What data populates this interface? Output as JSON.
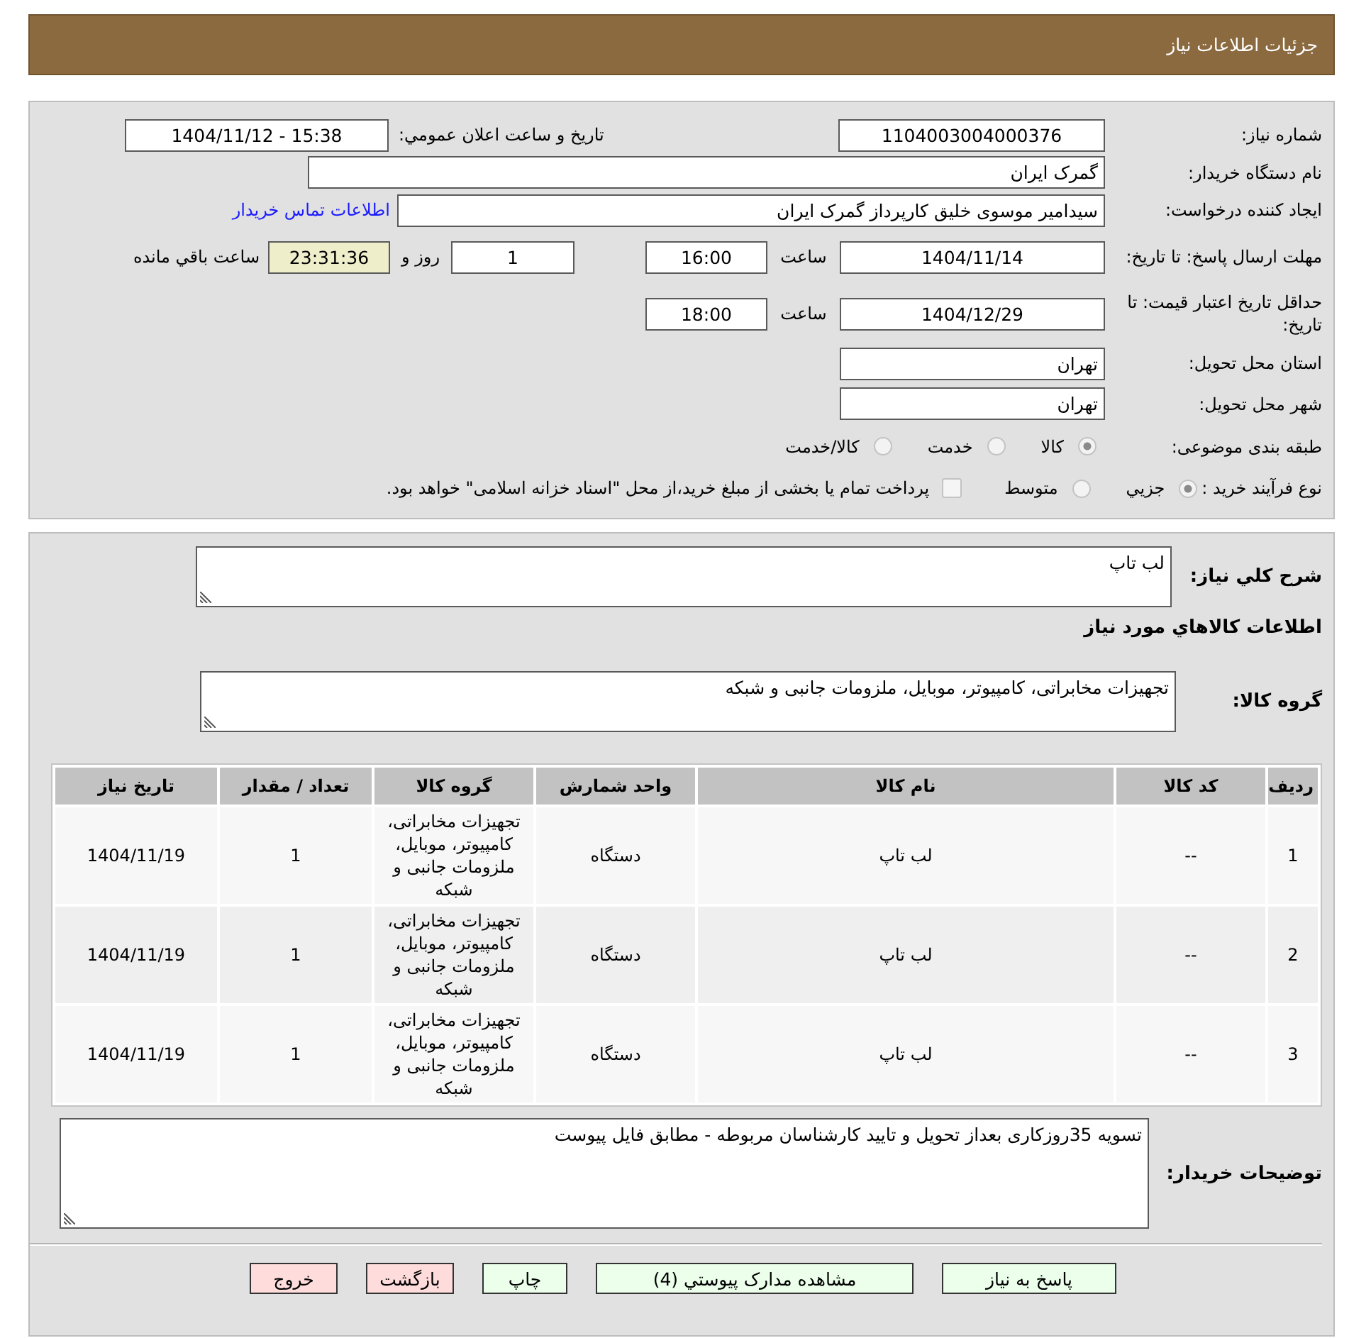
{
  "header": {
    "title": "جزئیات اطلاعات نیاز"
  },
  "details": {
    "need_number": {
      "label": "شماره نیاز:",
      "value": "1104003004000376"
    },
    "announce_datetime": {
      "label": "تاریخ و ساعت اعلان عمومي:",
      "value": "1404/11/12 - 15:38"
    },
    "buyer_org": {
      "label": "نام دستگاه خریدار:",
      "value": "گمرک ایران"
    },
    "requester": {
      "label": "ایجاد کننده درخواست:",
      "value": "سیدامیر موسوی خلیق کارپرداز گمرک ایران",
      "contact_link": "اطلاعات تماس خریدار"
    },
    "response_deadline": {
      "label": "مهلت ارسال پاسخ: تا تاریخ:",
      "date": "1404/11/14",
      "time_label": "ساعت",
      "time": "16:00",
      "days": "1",
      "days_label": "روز و",
      "remaining": "23:31:36",
      "remaining_label": "ساعت باقي مانده"
    },
    "price_validity": {
      "label": "حداقل تاریخ اعتبار قیمت: تا تاریخ:",
      "date": "1404/12/29",
      "time_label": "ساعت",
      "time": "18:00"
    },
    "province": {
      "label": "استان محل تحویل:",
      "value": "تهران"
    },
    "city": {
      "label": "شهر محل تحویل:",
      "value": "تهران"
    },
    "category": {
      "label": "طبقه بندی موضوعی:",
      "options": [
        {
          "label": "کالا",
          "selected": true
        },
        {
          "label": "خدمت",
          "selected": false
        },
        {
          "label": "کالا/خدمت",
          "selected": false
        }
      ]
    },
    "process": {
      "label": "نوع فرآیند خرید :",
      "options": [
        {
          "label": "جزيي",
          "selected": true
        },
        {
          "label": "متوسط",
          "selected": false
        }
      ],
      "payment": {
        "label": "پرداخت تمام یا بخشی از مبلغ خرید،از محل \"اسناد خزانه اسلامی\" خواهد بود.",
        "checked": false
      }
    }
  },
  "items": {
    "description": {
      "label": "شرح کلي نیاز:",
      "value": "لب تاپ"
    },
    "heading": "اطلاعات کالاهاي مورد نیاز",
    "goods_group": {
      "label": "گروه کالا:",
      "value": "تجهیزات مخابراتی، کامپیوتر، موبایل، ملزومات جانبی و شبکه"
    },
    "table": {
      "columns": [
        "ردیف",
        "کد کالا",
        "نام کالا",
        "واحد شمارش",
        "گروه کالا",
        "تعداد / مقدار",
        "تاریخ نیاز"
      ],
      "rows": [
        [
          "1",
          "--",
          "لب تاپ",
          "دستگاه",
          "تجهیزات مخابراتی، کامپیوتر، موبایل، ملزومات جانبی و شبکه",
          "1",
          "1404/11/19"
        ],
        [
          "2",
          "--",
          "لب تاپ",
          "دستگاه",
          "تجهیزات مخابراتی، کامپیوتر، موبایل، ملزومات جانبی و شبکه",
          "1",
          "1404/11/19"
        ],
        [
          "3",
          "--",
          "لب تاپ",
          "دستگاه",
          "تجهیزات مخابراتی، کامپیوتر، موبایل، ملزومات جانبی و شبکه",
          "1",
          "1404/11/19"
        ]
      ]
    },
    "buyer_notes": {
      "label": "توضیحات خریدار:",
      "value": "تسویه 35روزکاری بعداز تحویل و تایید کارشناسان مربوطه - مطابق فایل پیوست"
    }
  },
  "buttons": [
    {
      "label": "پاسخ به نیاز",
      "kind": "normal"
    },
    {
      "label": "مشاهده مدارک پیوستي (4)",
      "kind": "normal"
    },
    {
      "label": "چاپ",
      "kind": "normal"
    },
    {
      "label": "بازگشت",
      "kind": "warning"
    },
    {
      "label": "خروج",
      "kind": "warning"
    }
  ]
}
